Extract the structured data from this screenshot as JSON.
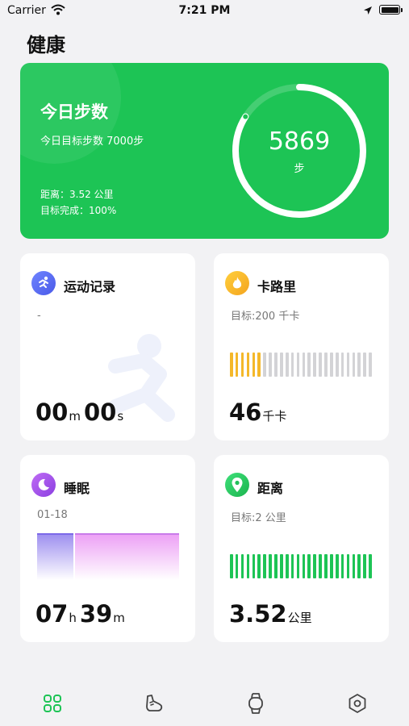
{
  "status_bar": {
    "carrier": "Carrier",
    "time": "7:21 PM"
  },
  "page_title": "健康",
  "steps_card": {
    "title": "今日步数",
    "goal_text": "今日目标步数 7000步",
    "distance_text": "距离：3.52 公里",
    "completion_text": "目标完成：100%",
    "steps_value": "5869",
    "steps_unit": "步",
    "progress": 0.84
  },
  "exercise_card": {
    "title": "运动记录",
    "subtitle": "-",
    "minutes": "00",
    "minutes_unit": "m",
    "seconds": "00",
    "seconds_unit": "s"
  },
  "calorie_card": {
    "title": "卡路里",
    "goal_text": "目标:200 千卡",
    "value": "46",
    "unit": "千卡",
    "progress": 0.23,
    "bar_count": 26,
    "active_color": "#f4b82a",
    "inactive_color": "#d3d3d6"
  },
  "sleep_card": {
    "title": "睡眠",
    "date": "01-18",
    "hours": "07",
    "hours_unit": "h",
    "minutes": "39",
    "minutes_unit": "m"
  },
  "distance_card": {
    "title": "距离",
    "goal_text": "目标:2 公里",
    "value": "3.52",
    "unit": "公里",
    "progress": 1.0,
    "bar_count": 26,
    "active_color": "#1dc455",
    "inactive_color": "#d3d3d6"
  },
  "tab_bar": {
    "tabs": [
      {
        "name": "home",
        "icon": "grid-icon",
        "active": true
      },
      {
        "name": "sport",
        "icon": "shoe-icon",
        "active": false
      },
      {
        "name": "device",
        "icon": "watch-icon",
        "active": false
      },
      {
        "name": "settings",
        "icon": "hexagon-settings-icon",
        "active": false
      }
    ]
  },
  "colors": {
    "accent": "#1dc455",
    "calorie": "#f4b82a",
    "sleep": "#9a49e6",
    "exercise": "#5b6cf0"
  }
}
